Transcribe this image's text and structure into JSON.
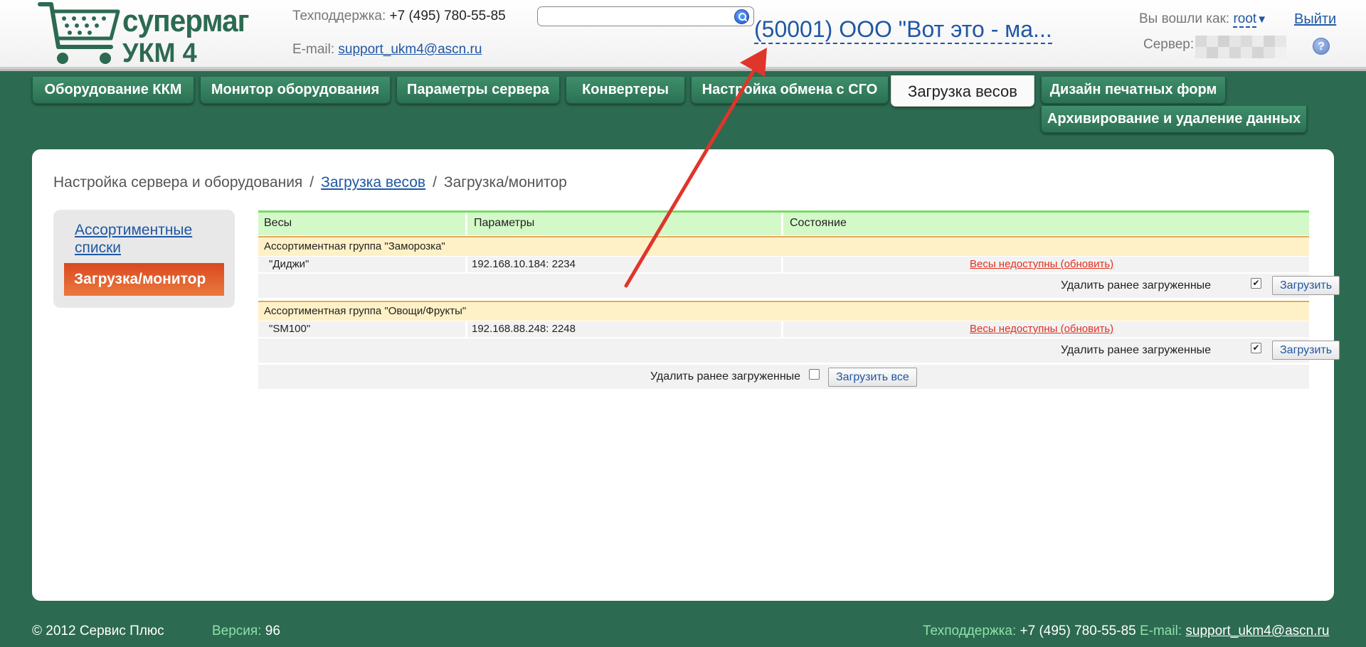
{
  "header": {
    "logo_line1": "супермаг",
    "logo_line2": "УКМ 4",
    "support_label": "Техподдержка:",
    "support_phone": "+7 (495) 780-55-85",
    "email_label": "E-mail:",
    "email": "support_ukm4@ascn.ru",
    "search_placeholder": "",
    "org_title": "(50001) ООО \"Вот это - ма...",
    "logged_in_label": "Вы вошли как:",
    "user": "root",
    "user_caret": "▼",
    "logout": "Выйти",
    "server_label": "Сервер:",
    "help_icon": "?"
  },
  "tabs": [
    {
      "label": "Оборудование ККМ"
    },
    {
      "label": "Монитор оборудования"
    },
    {
      "label": "Параметры сервера"
    },
    {
      "label": "Конвертеры"
    },
    {
      "label": "Настройка обмена с СГО"
    },
    {
      "label": "Загрузка весов",
      "active": true
    },
    {
      "label": "Дизайн печатных форм"
    },
    {
      "label": "Архивирование и удаление данных"
    }
  ],
  "breadcrumb": {
    "item1": "Настройка сервера и оборудования",
    "item2": "Загрузка весов",
    "item3": "Загрузка/монитор",
    "sep": "/"
  },
  "sidebar": {
    "link": "Ассортиментные списки",
    "active": "Загрузка/монитор"
  },
  "grid": {
    "headers": [
      "Весы",
      "Параметры",
      "Состояние"
    ],
    "groups": [
      {
        "title": "Ассортиментная группа \"Заморозка\"",
        "scale": "\"Диджи\"",
        "address": "192.168.10.184: 2234",
        "status": "Весы недоступны (обновить)",
        "delete_label": "Удалить ранее загруженные",
        "delete_checked": true,
        "load_button": "Загрузить"
      },
      {
        "title": "Ассортиментная группа \"Овощи/Фрукты\"",
        "scale": "\"SM100\"",
        "address": "192.168.88.248: 2248",
        "status": "Весы недоступны (обновить)",
        "delete_label": "Удалить ранее загруженные",
        "delete_checked": true,
        "load_button": "Загрузить"
      }
    ],
    "all": {
      "delete_label": "Удалить ранее загруженные",
      "delete_checked": false,
      "load_all_button": "Загрузить все"
    }
  },
  "footer": {
    "copyright": "© 2012 Сервис Плюс",
    "version_label": "Версия:",
    "version": "96",
    "support_label": "Техподдержка:",
    "support_phone": "+7 (495) 780-55-85",
    "email_label": "E-mail:",
    "email": "support_ukm4@ascn.ru"
  },
  "colors": {
    "background": "#2c6a51",
    "tab": "#2b7154",
    "link": "#1f57a4",
    "active_side": "#e0582a",
    "error": "#e03020",
    "arrow": "#e0352b"
  }
}
